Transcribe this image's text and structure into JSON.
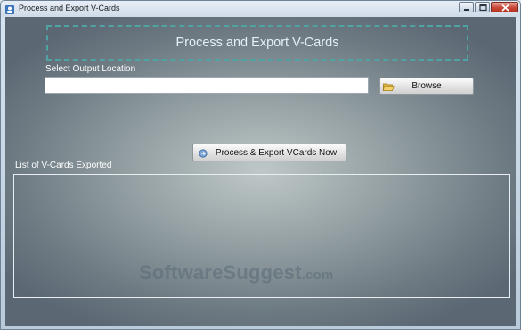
{
  "window": {
    "title": "Process and Export V-Cards"
  },
  "header": {
    "title": "Process and Export V-Cards"
  },
  "output": {
    "label": "Select Output Location",
    "value": "",
    "browse_label": "Browse"
  },
  "actions": {
    "process_label": "Process & Export VCards Now"
  },
  "list": {
    "label": "List of V-Cards Exported",
    "items": []
  },
  "watermark": {
    "main": "SoftwareSuggest",
    "suffix": ".com"
  },
  "icons": {
    "app": "vcard-app-icon",
    "browse": "folder-icon",
    "process": "export-icon",
    "minimize": "minimize-icon",
    "maximize": "maximize-icon",
    "close": "close-icon"
  }
}
